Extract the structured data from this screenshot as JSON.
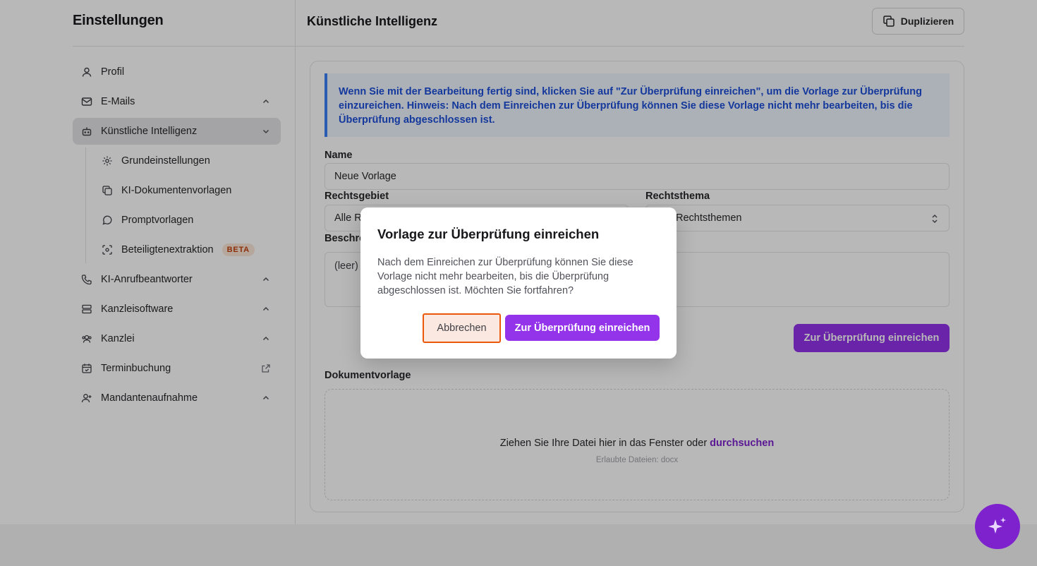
{
  "sidebar": {
    "title": "Einstellungen",
    "items": [
      {
        "label": "Profil",
        "icon": "user-icon"
      },
      {
        "label": "E-Mails",
        "icon": "mail-icon"
      },
      {
        "label": "Künstliche Intelligenz",
        "icon": "bot-icon"
      },
      {
        "label": "KI-Anrufbeantworter",
        "icon": "phone-icon"
      },
      {
        "label": "Kanzleisoftware",
        "icon": "server-icon"
      },
      {
        "label": "Kanzlei",
        "icon": "users-icon"
      },
      {
        "label": "Terminbuchung",
        "icon": "calendar-icon"
      },
      {
        "label": "Mandantenaufnahme",
        "icon": "user-plus-icon"
      }
    ],
    "subitems": [
      {
        "label": "Grundeinstellungen",
        "icon": "gear-icon"
      },
      {
        "label": "KI-Dokumentenvorlagen",
        "icon": "copy-icon"
      },
      {
        "label": "Promptvorlagen",
        "icon": "chat-icon"
      },
      {
        "label": "Beteiligtenextraktion",
        "icon": "scan-icon"
      }
    ],
    "beta_badge": "BETA"
  },
  "main": {
    "title": "Künstliche Intelligenz",
    "duplicate_label": "Duplizieren",
    "info": {
      "text_start": "Wenn Sie mit der Bearbeitung fertig sind, klicken Sie auf \"Zur Überprüfung einreichen\", um die Vorlage zur Überprüfung einzureichen. ",
      "hint_label": "Hinweis:",
      "text_end": " Nach dem Einreichen zur Überprüfung können Sie diese Vorlage nicht mehr bearbeiten, bis die Überprüfung abgeschlossen ist."
    },
    "name_label": "Name",
    "name_value": "Neue Vorlage",
    "rechtsgebiet_label": "Rechtsgebiet",
    "rechtsgebiet_value": "Alle R",
    "rechtsthema_label": "Rechtsthema",
    "rechtsthema_value": "Rechtsthemen",
    "beschreibung_label": "Beschre",
    "beschreibung_value": "(leer)",
    "submit_label": "Zur Überprüfung einreichen",
    "dokument_label": "Dokumentvorlage",
    "drop_text": "Ziehen Sie Ihre Datei hier in das Fenster oder ",
    "drop_link": "durchsuchen",
    "drop_hint": "Erlaubte Dateien: docx"
  },
  "dialog": {
    "title": "Vorlage zur Überprüfung einreichen",
    "body": "Nach dem Einreichen zur Überprüfung können Sie diese Vorlage nicht mehr bearbeiten, bis die Überprüfung abgeschlossen ist. Möchten Sie fortfahren?",
    "cancel_label": "Abbrechen",
    "confirm_label": "Zur Überprüfung einreichen"
  },
  "fab": {
    "icon": "sparkle-icon"
  },
  "colors": {
    "accent": "#9333ea",
    "info_text": "#1d4ed8",
    "focus_ring": "#ea580c"
  }
}
